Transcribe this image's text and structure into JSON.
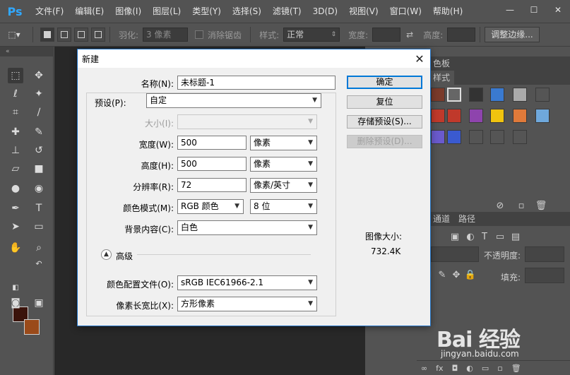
{
  "app": {
    "logo": "Ps"
  },
  "menu": [
    "文件(F)",
    "编辑(E)",
    "图像(I)",
    "图层(L)",
    "类型(Y)",
    "选择(S)",
    "滤镜(T)",
    "3D(D)",
    "视图(V)",
    "窗口(W)",
    "帮助(H)"
  ],
  "window_controls": {
    "minimize": "—",
    "maximize": "☐",
    "close": "✕"
  },
  "options": {
    "feather_label": "羽化:",
    "feather_value": "3 像素",
    "antialias_label": "消除锯齿",
    "style_label": "样式:",
    "style_value": "正常",
    "width_label": "宽度:",
    "height_label": "高度:",
    "refine_edge": "调整边缘..."
  },
  "panels": {
    "tab_top": "色板",
    "tab_styles": "样式",
    "tab_channels": "通道",
    "tab_paths": "路径",
    "opacity_label": "不透明度:",
    "fill_label": "填充:"
  },
  "dialog": {
    "title": "新建",
    "name_label": "名称(N):",
    "name_value": "未标题-1",
    "preset_label": "预设(P):",
    "preset_value": "自定",
    "size_label": "大小(I):",
    "size_value": "",
    "width_label": "宽度(W):",
    "width_value": "500",
    "width_unit": "像素",
    "height_label": "高度(H):",
    "height_value": "500",
    "height_unit": "像素",
    "resolution_label": "分辨率(R):",
    "resolution_value": "72",
    "resolution_unit": "像素/英寸",
    "color_mode_label": "颜色模式(M):",
    "color_mode_value": "RGB 颜色",
    "bit_depth_value": "8 位",
    "background_label": "背景内容(C):",
    "background_value": "白色",
    "advanced_label": "高级",
    "color_profile_label": "颜色配置文件(O):",
    "color_profile_value": "sRGB IEC61966-2.1",
    "pixel_aspect_label": "像素长宽比(X):",
    "pixel_aspect_value": "方形像素",
    "ok": "确定",
    "reset": "复位",
    "save_preset": "存储预设(S)...",
    "delete_preset": "删除预设(D)...",
    "image_size_label": "图像大小:",
    "image_size_value": "732.4K"
  },
  "colors": {
    "foreground": "#3a130b",
    "background": "#9a4a1a",
    "dialog_border": "#1e6fc2"
  },
  "watermark": {
    "logo": "Bai 经验",
    "url": "jingyan.baidu.com"
  }
}
